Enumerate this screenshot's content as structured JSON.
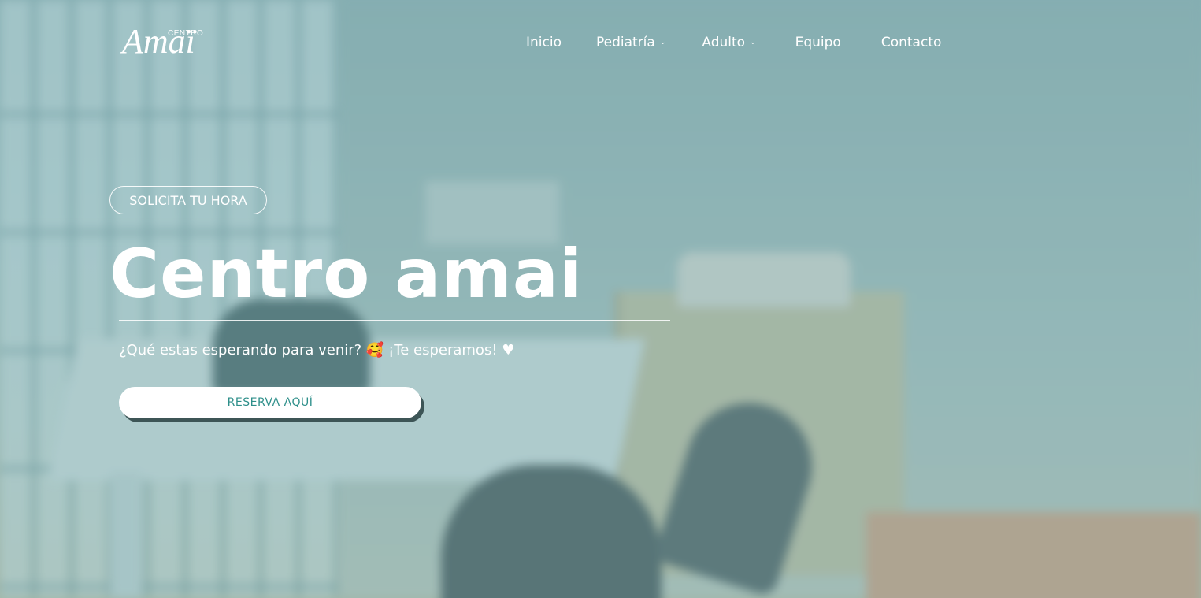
{
  "header": {
    "logo": {
      "small_text": "CENTRO",
      "script_text": "Amaï"
    },
    "nav": [
      {
        "label": "Inicio",
        "dropdown": false
      },
      {
        "label": "Pediatría",
        "dropdown": true
      },
      {
        "label": "Adulto",
        "dropdown": true
      },
      {
        "label": "Equipo",
        "dropdown": false
      },
      {
        "label": "Contacto",
        "dropdown": false
      }
    ]
  },
  "hero": {
    "tag": "SOLICITA TU HORA",
    "title": "Centro amai",
    "subtitle": "¿Qué estas esperando para venir? 🥰 ¡Te esperamos! ♥",
    "cta_label": "RESERVA AQUÍ"
  },
  "colors": {
    "accent": "#2e8f8a",
    "overlay": "#6ea0a5",
    "text": "#ffffff"
  },
  "icons": {
    "dropdown": "chevron-down-icon"
  }
}
